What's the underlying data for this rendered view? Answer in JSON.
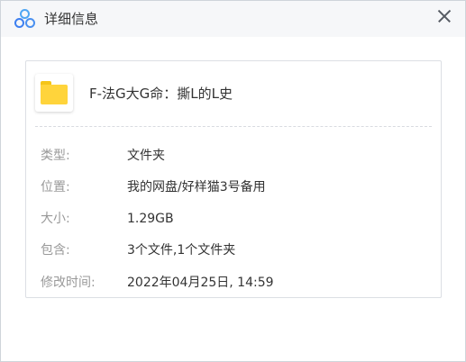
{
  "window": {
    "title": "详细信息",
    "close_icon": "close-icon",
    "app_icon": "baidu-netdisk-icon"
  },
  "file": {
    "icon": "folder-icon",
    "name": "F-法G大G命：撕L的L史"
  },
  "details": [
    {
      "label": "类型:",
      "value": "文件夹"
    },
    {
      "label": "位置:",
      "value": "我的网盘/好样猫3号备用"
    },
    {
      "label": "大小:",
      "value": "1.29GB"
    },
    {
      "label": "包含:",
      "value": "3个文件,1个文件夹"
    },
    {
      "label": "修改时间:",
      "value": "2022年04月25日, 14:59"
    }
  ],
  "colors": {
    "title_bar": "#f6f7f9",
    "label": "#999999",
    "value": "#333333",
    "folder": "#ffd43b",
    "accent": "#4a90f0"
  }
}
